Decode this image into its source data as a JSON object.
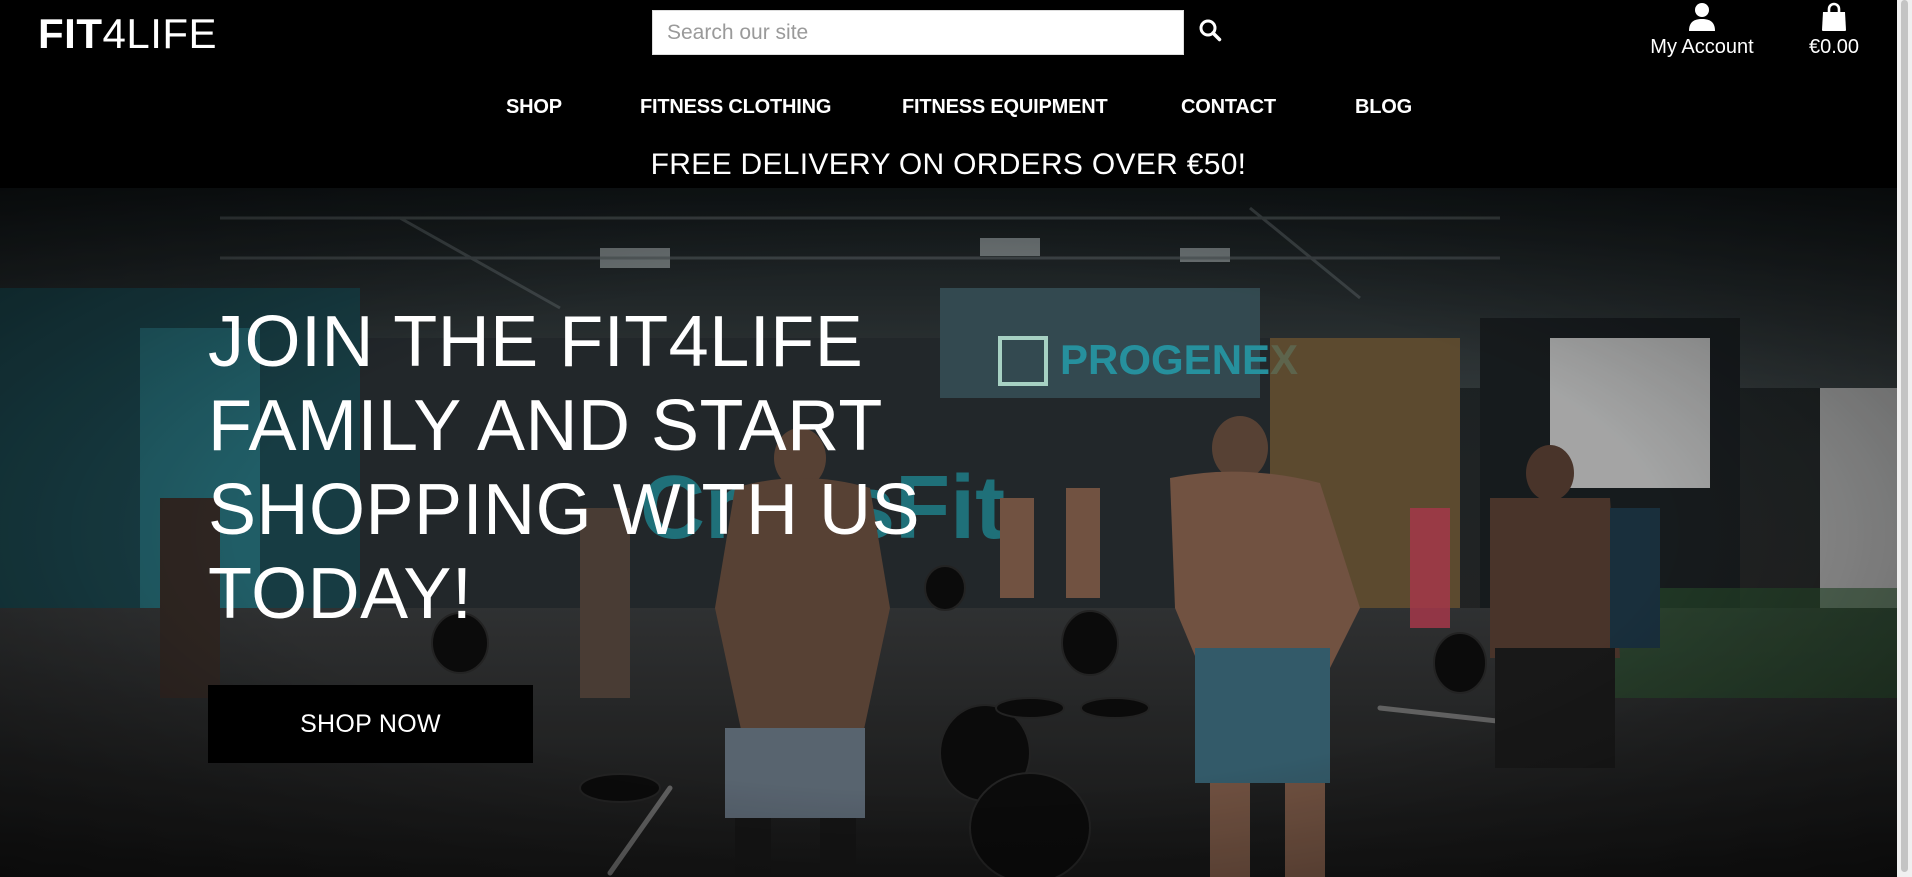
{
  "header": {
    "logo_bold": "FIT",
    "logo_light": "4LIFE",
    "search_placeholder": "Search our site",
    "search_value": "",
    "account_label": "My Account",
    "cart_total": "€0.00"
  },
  "nav": {
    "items": [
      {
        "label": "SHOP"
      },
      {
        "label": "FITNESS CLOTHING"
      },
      {
        "label": "FITNESS EQUIPMENT"
      },
      {
        "label": "CONTACT"
      },
      {
        "label": "BLOG"
      }
    ]
  },
  "promo": {
    "text": "FREE DELIVERY ON ORDERS OVER €50!"
  },
  "hero": {
    "title": "JOIN THE FIT4LIFE FAMILY AND START SHOPPING WITH US TODAY!",
    "cta_label": "SHOP NOW",
    "sign_text": "PROGENEX"
  },
  "icons": {
    "search": "search-icon",
    "account": "user-icon",
    "cart": "shopping-bag-icon"
  },
  "colors": {
    "header_bg": "#000000",
    "text": "#ffffff",
    "cta_bg": "#000000",
    "sign_accent": "#2fb0c0"
  }
}
